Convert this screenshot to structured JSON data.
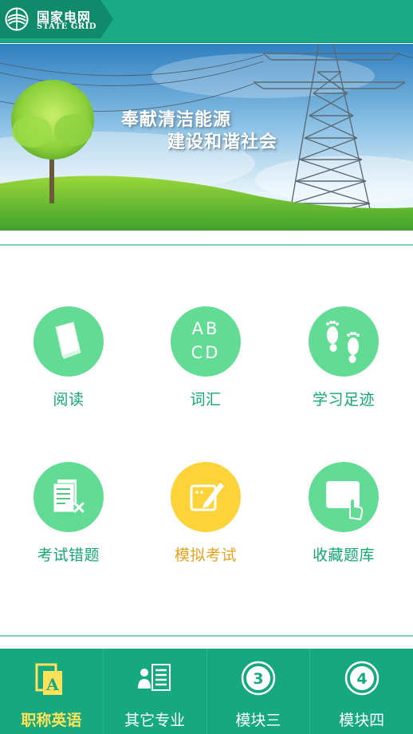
{
  "brand": {
    "name_cn": "国家电网",
    "name_en": "STATE GRID"
  },
  "banner": {
    "line1": "奉献清洁能源",
    "line2": "建设和谐社会"
  },
  "grid": {
    "items": [
      {
        "label": "阅读",
        "icon": "book-icon"
      },
      {
        "label": "词汇",
        "icon": "abcd-icon",
        "icon_text_1": "AB",
        "icon_text_2": "CD"
      },
      {
        "label": "学习足迹",
        "icon": "footprints-icon"
      },
      {
        "label": "考试错题",
        "icon": "wrong-paper-icon"
      },
      {
        "label": "模拟考试",
        "icon": "edit-exam-icon",
        "highlight": true
      },
      {
        "label": "收藏题库",
        "icon": "tap-screen-icon"
      }
    ]
  },
  "bottom_nav": {
    "items": [
      {
        "label": "职称英语",
        "icon": "english-book-icon",
        "active": true
      },
      {
        "label": "其它专业",
        "icon": "list-icon"
      },
      {
        "label": "模块三",
        "icon": "circle-3-icon",
        "badge": "3"
      },
      {
        "label": "模块四",
        "icon": "circle-4-icon",
        "badge": "4"
      }
    ]
  },
  "colors": {
    "primary": "#16a97f",
    "icon_green": "#62dc94",
    "icon_yellow": "#fcd43a",
    "label_green": "#14a676",
    "active_nav": "#ffe15a"
  }
}
